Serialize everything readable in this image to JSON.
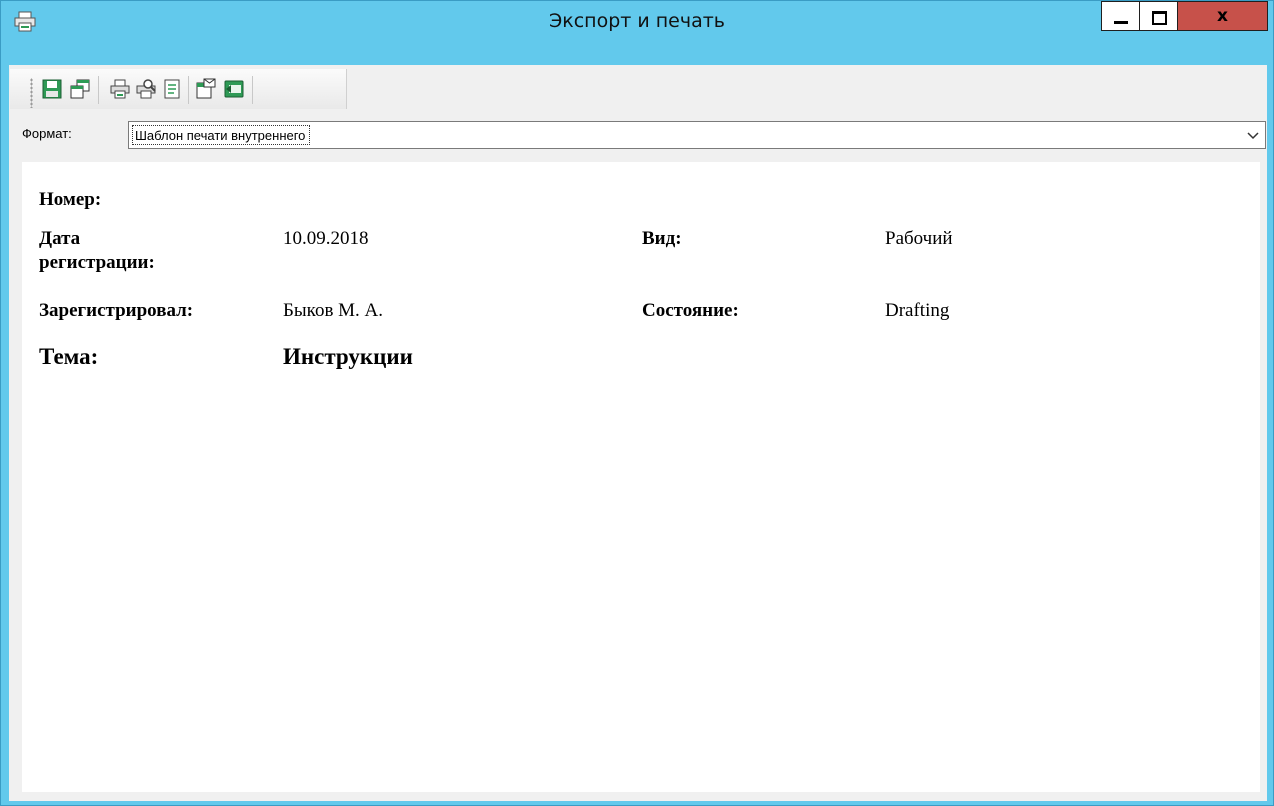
{
  "window": {
    "title": "Экспорт и печать",
    "close_glyph": "x"
  },
  "toolbar": {
    "buttons": [
      {
        "icon": "save-icon"
      },
      {
        "icon": "copy-icon"
      },
      {
        "icon": "print-icon"
      },
      {
        "icon": "print-preview-icon"
      },
      {
        "icon": "page-setup-icon"
      },
      {
        "icon": "send-mail-icon"
      },
      {
        "icon": "export-icon"
      }
    ]
  },
  "format": {
    "label": "Формат:",
    "value": "Шаблон печати внутреннего"
  },
  "document": {
    "number_label": "Номер:",
    "number_value": "",
    "reg_date_label_1": "Дата",
    "reg_date_label_2": "регистрации:",
    "reg_date_value": "10.09.2018",
    "type_label": "Вид:",
    "type_value": "Рабочий",
    "registered_by_label": "Зарегистрировал:",
    "registered_by_value": "Быков М. А.",
    "state_label": "Состояние:",
    "state_value": "Drafting",
    "subject_label": "Тема:",
    "subject_value": "Инструкции"
  },
  "colors": {
    "titlebar": "#62c9ec",
    "close_button": "#c7514a",
    "icon_green": "#2e9a55"
  }
}
